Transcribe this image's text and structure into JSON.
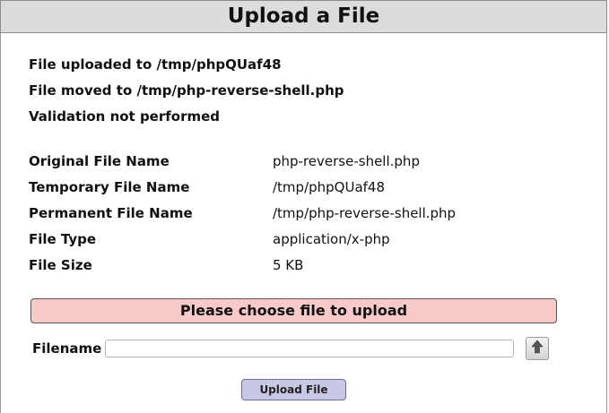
{
  "header": {
    "title": "Upload a File"
  },
  "status": [
    "File uploaded to /tmp/phpQUaf48",
    "File moved to /tmp/php-reverse-shell.php",
    "Validation not performed"
  ],
  "file_info": [
    {
      "label": "Original File Name",
      "value": "php-reverse-shell.php"
    },
    {
      "label": "Temporary File Name",
      "value": "/tmp/phpQUaf48"
    },
    {
      "label": "Permanent File Name",
      "value": "/tmp/php-reverse-shell.php"
    },
    {
      "label": "File Type",
      "value": "application/x-php"
    },
    {
      "label": "File Size",
      "value": "5 KB"
    }
  ],
  "alert": {
    "message": "Please choose file to upload"
  },
  "form": {
    "filename_label": "Filename",
    "filename_value": "",
    "browse_icon": "upload-arrow-icon",
    "submit_label": "Upload File"
  },
  "colors": {
    "alert_bg": "#f7c9c9",
    "button_bg": "#c8c8e6",
    "title_bg": "#dcdcdc"
  }
}
